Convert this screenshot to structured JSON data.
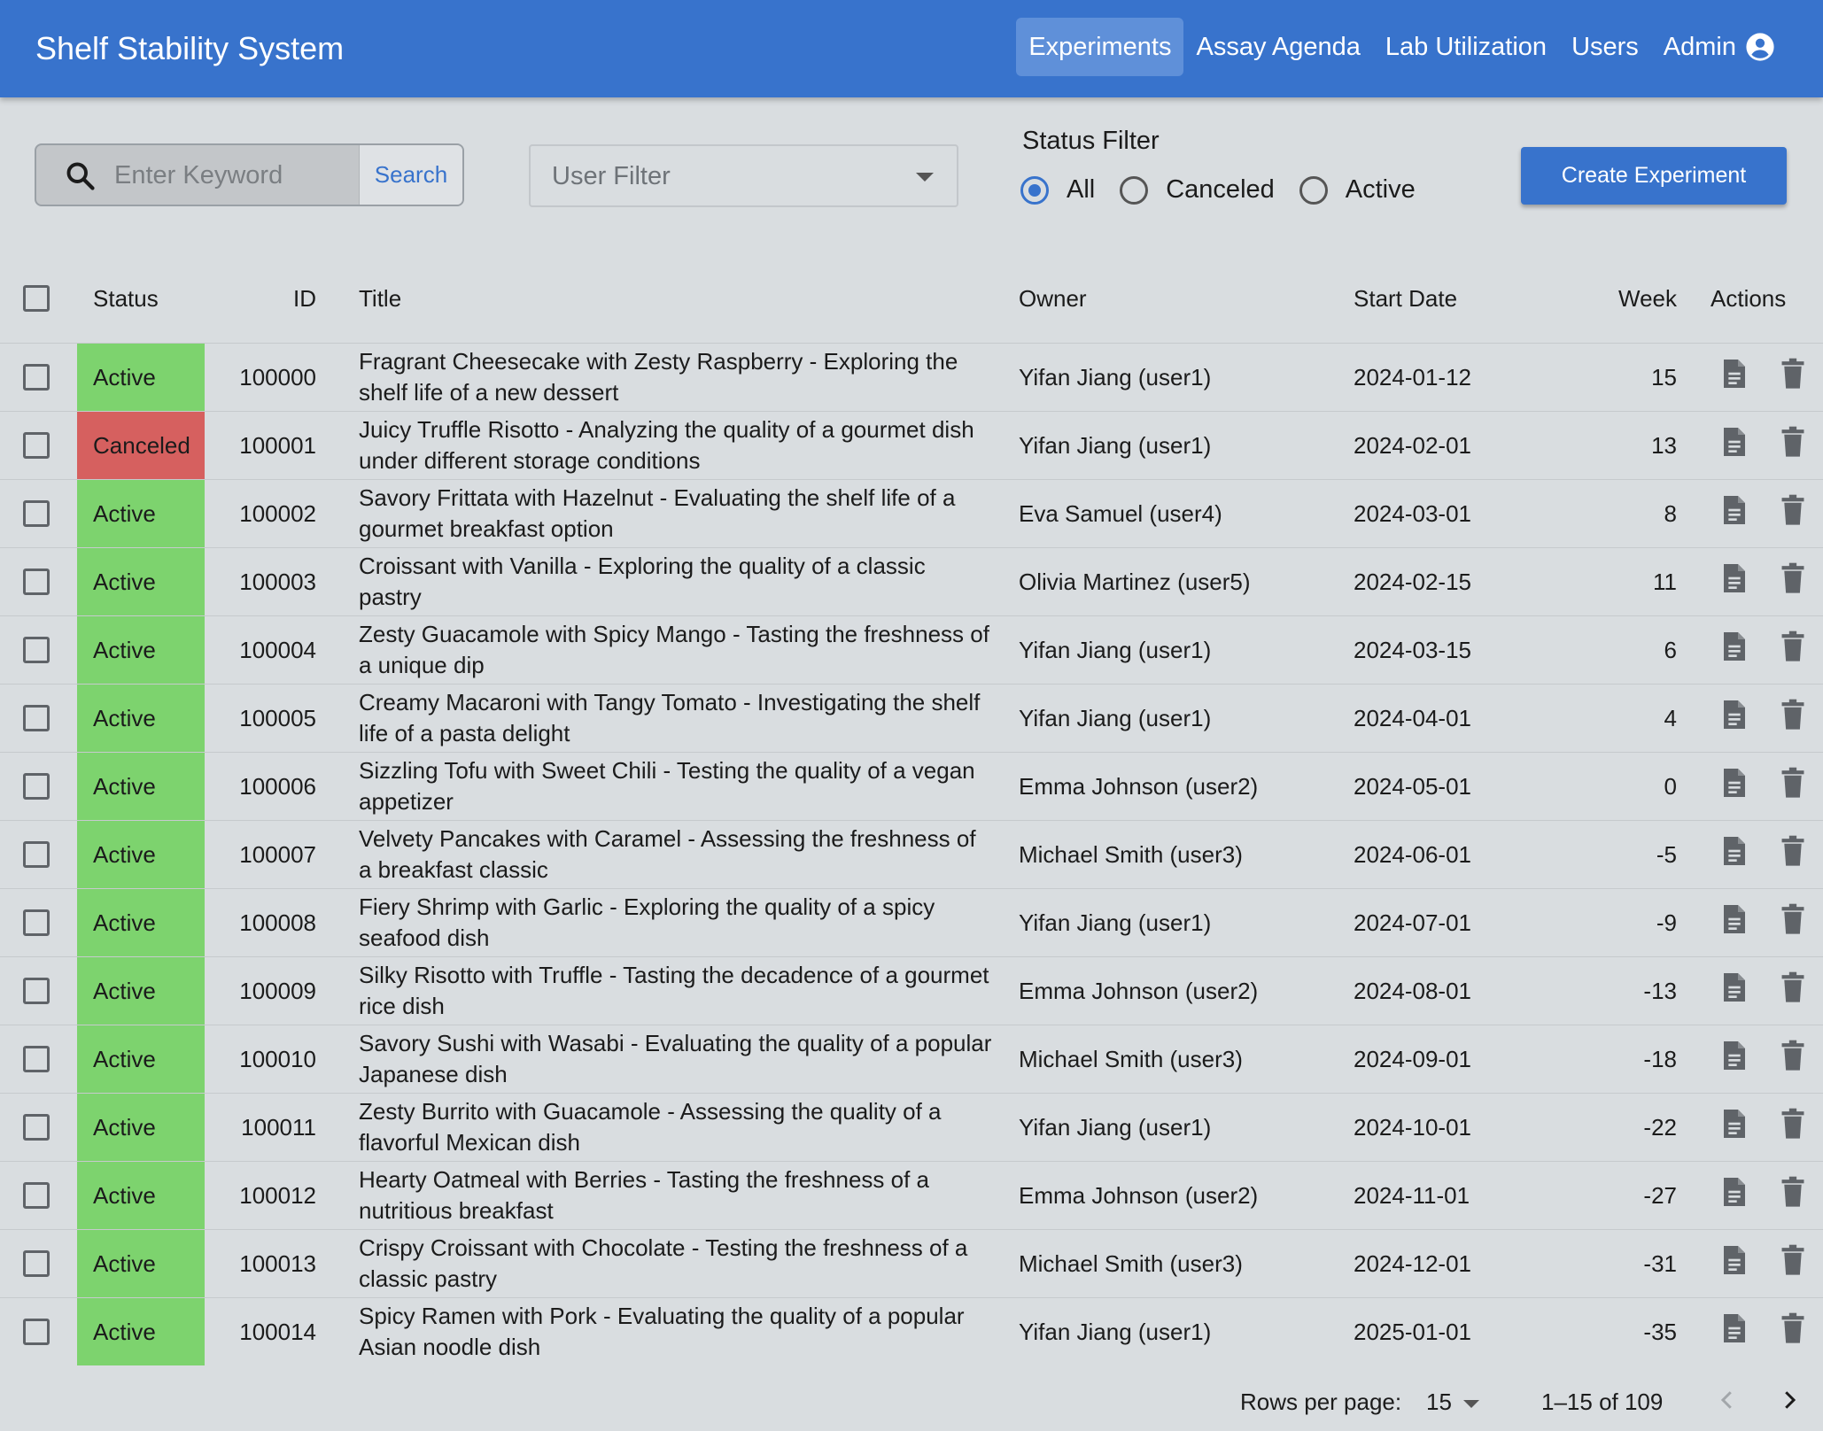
{
  "app": {
    "title": "Shelf Stability System",
    "nav": [
      "Experiments",
      "Assay Agenda",
      "Lab Utilization",
      "Users",
      "Admin"
    ],
    "active_nav": "Experiments"
  },
  "toolbar": {
    "search_placeholder": "Enter Keyword",
    "search_button": "Search",
    "user_filter_label": "User Filter",
    "status_filter_title": "Status Filter",
    "status_options": [
      "All",
      "Canceled",
      "Active"
    ],
    "status_selected": "All",
    "create_button": "Create Experiment"
  },
  "table": {
    "columns": [
      "Status",
      "ID",
      "Title",
      "Owner",
      "Start Date",
      "Week",
      "Actions"
    ],
    "rows": [
      {
        "status": "Active",
        "id": "100000",
        "title": "Fragrant Cheesecake with Zesty Raspberry - Exploring the shelf life of a new dessert",
        "owner": "Yifan Jiang (user1)",
        "start_date": "2024-01-12",
        "week": "15"
      },
      {
        "status": "Canceled",
        "id": "100001",
        "title": "Juicy Truffle Risotto - Analyzing the quality of a gourmet dish under different storage conditions",
        "owner": "Yifan Jiang (user1)",
        "start_date": "2024-02-01",
        "week": "13"
      },
      {
        "status": "Active",
        "id": "100002",
        "title": "Savory Frittata with Hazelnut - Evaluating the shelf life of a gourmet breakfast option",
        "owner": "Eva Samuel (user4)",
        "start_date": "2024-03-01",
        "week": "8"
      },
      {
        "status": "Active",
        "id": "100003",
        "title": "Croissant with Vanilla - Exploring the quality of a classic pastry",
        "owner": "Olivia Martinez (user5)",
        "start_date": "2024-02-15",
        "week": "11"
      },
      {
        "status": "Active",
        "id": "100004",
        "title": "Zesty Guacamole with Spicy Mango - Tasting the freshness of a unique dip",
        "owner": "Yifan Jiang (user1)",
        "start_date": "2024-03-15",
        "week": "6"
      },
      {
        "status": "Active",
        "id": "100005",
        "title": "Creamy Macaroni with Tangy Tomato - Investigating the shelf life of a pasta delight",
        "owner": "Yifan Jiang (user1)",
        "start_date": "2024-04-01",
        "week": "4"
      },
      {
        "status": "Active",
        "id": "100006",
        "title": "Sizzling Tofu with Sweet Chili - Testing the quality of a vegan appetizer",
        "owner": "Emma Johnson (user2)",
        "start_date": "2024-05-01",
        "week": "0"
      },
      {
        "status": "Active",
        "id": "100007",
        "title": "Velvety Pancakes with Caramel - Assessing the freshness of a breakfast classic",
        "owner": "Michael Smith (user3)",
        "start_date": "2024-06-01",
        "week": "-5"
      },
      {
        "status": "Active",
        "id": "100008",
        "title": "Fiery Shrimp with Garlic - Exploring the quality of a spicy seafood dish",
        "owner": "Yifan Jiang (user1)",
        "start_date": "2024-07-01",
        "week": "-9"
      },
      {
        "status": "Active",
        "id": "100009",
        "title": "Silky Risotto with Truffle - Tasting the decadence of a gourmet rice dish",
        "owner": "Emma Johnson (user2)",
        "start_date": "2024-08-01",
        "week": "-13"
      },
      {
        "status": "Active",
        "id": "100010",
        "title": "Savory Sushi with Wasabi - Evaluating the quality of a popular Japanese dish",
        "owner": "Michael Smith (user3)",
        "start_date": "2024-09-01",
        "week": "-18"
      },
      {
        "status": "Active",
        "id": "100011",
        "title": "Zesty Burrito with Guacamole - Assessing the quality of a flavorful Mexican dish",
        "owner": "Yifan Jiang (user1)",
        "start_date": "2024-10-01",
        "week": "-22"
      },
      {
        "status": "Active",
        "id": "100012",
        "title": "Hearty Oatmeal with Berries - Tasting the freshness of a nutritious breakfast",
        "owner": "Emma Johnson (user2)",
        "start_date": "2024-11-01",
        "week": "-27"
      },
      {
        "status": "Active",
        "id": "100013",
        "title": "Crispy Croissant with Chocolate - Testing the freshness of a classic pastry",
        "owner": "Michael Smith (user3)",
        "start_date": "2024-12-01",
        "week": "-31"
      },
      {
        "status": "Active",
        "id": "100014",
        "title": "Spicy Ramen with Pork - Evaluating the quality of a popular Asian noodle dish",
        "owner": "Yifan Jiang (user1)",
        "start_date": "2025-01-01",
        "week": "-35"
      }
    ]
  },
  "pagination": {
    "rows_per_page_label": "Rows per page:",
    "rows_per_page": "15",
    "range": "1–15 of 109"
  },
  "colors": {
    "appbar": "#3873cc",
    "active_status": "#7dd36e",
    "canceled_status": "#d6605f"
  },
  "icons": [
    "search-icon",
    "account-circle-icon",
    "chevron-down-icon",
    "document-icon",
    "trash-icon",
    "chevron-left-icon",
    "chevron-right-icon"
  ]
}
